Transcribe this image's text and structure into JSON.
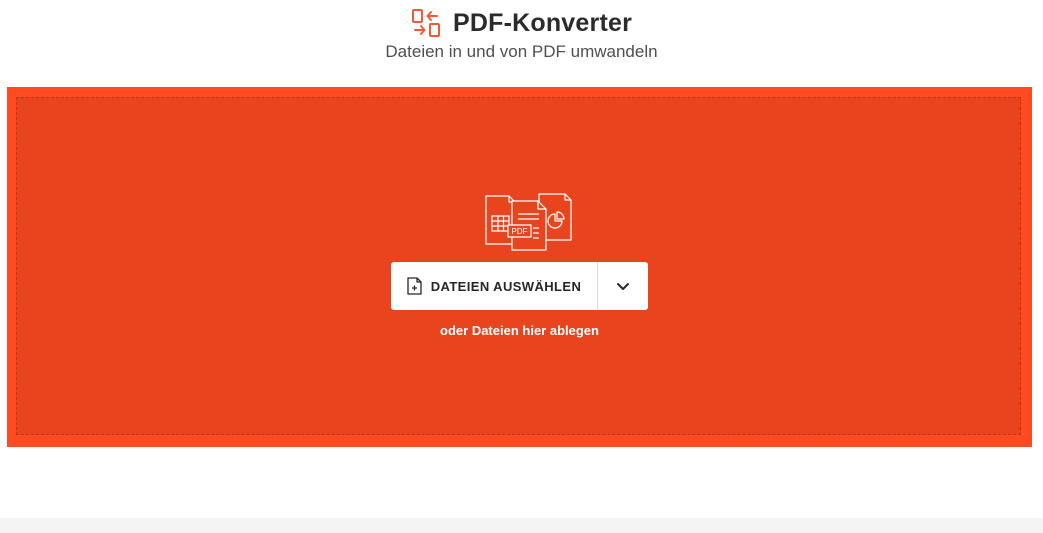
{
  "header": {
    "title": "PDF-Konverter",
    "subtitle": "Dateien in und von PDF umwandeln",
    "icon": "convert-arrows-icon"
  },
  "dropzone": {
    "illustration_icon": "documents-illustration-icon",
    "illustration_badge": "PDF",
    "choose_button_label": "DATEIEN AUSWÄHLEN",
    "choose_button_icon": "file-add-icon",
    "dropdown_icon": "chevron-down-icon",
    "drop_hint": "oder Dateien hier ablegen"
  },
  "colors": {
    "accent": "#e8451f",
    "accent_border": "#ff4a22",
    "icon_accent": "#f05a3a",
    "text_dark": "#2b2b2b",
    "footer_bg": "#f4f4f4"
  }
}
